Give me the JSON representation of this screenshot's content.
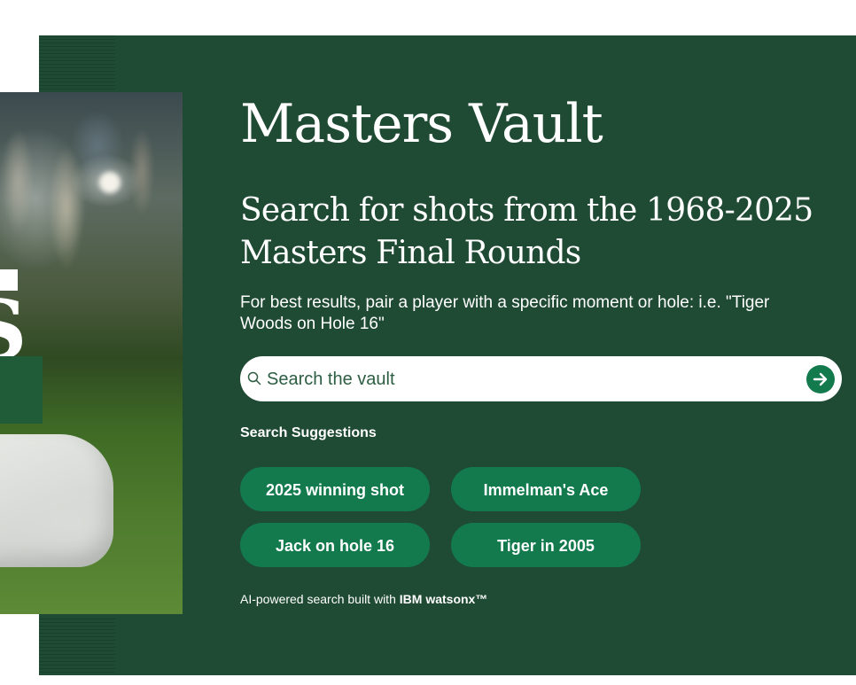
{
  "hero": {
    "title": "Masters Vault",
    "subtitle": "Search for shots from the 1968-2025 Masters Final Rounds",
    "hint": "For best results, pair a player with a specific moment or hole: i.e. \"Tiger Woods on Hole 16\""
  },
  "search": {
    "placeholder": "Search the vault",
    "value": "",
    "icon": "search-icon",
    "submit_icon": "arrow-right-icon"
  },
  "suggestions": {
    "heading": "Search Suggestions",
    "items": [
      {
        "label": "2025 winning shot"
      },
      {
        "label": "Immelman's Ace"
      },
      {
        "label": "Jack on hole 16"
      },
      {
        "label": "Tiger in 2005"
      }
    ]
  },
  "footer": {
    "prefix": "AI-powered search built with ",
    "brand": "IBM watsonx™"
  },
  "colors": {
    "panel": "#1f4a33",
    "accent": "#137a4e",
    "text": "#ffffff"
  }
}
